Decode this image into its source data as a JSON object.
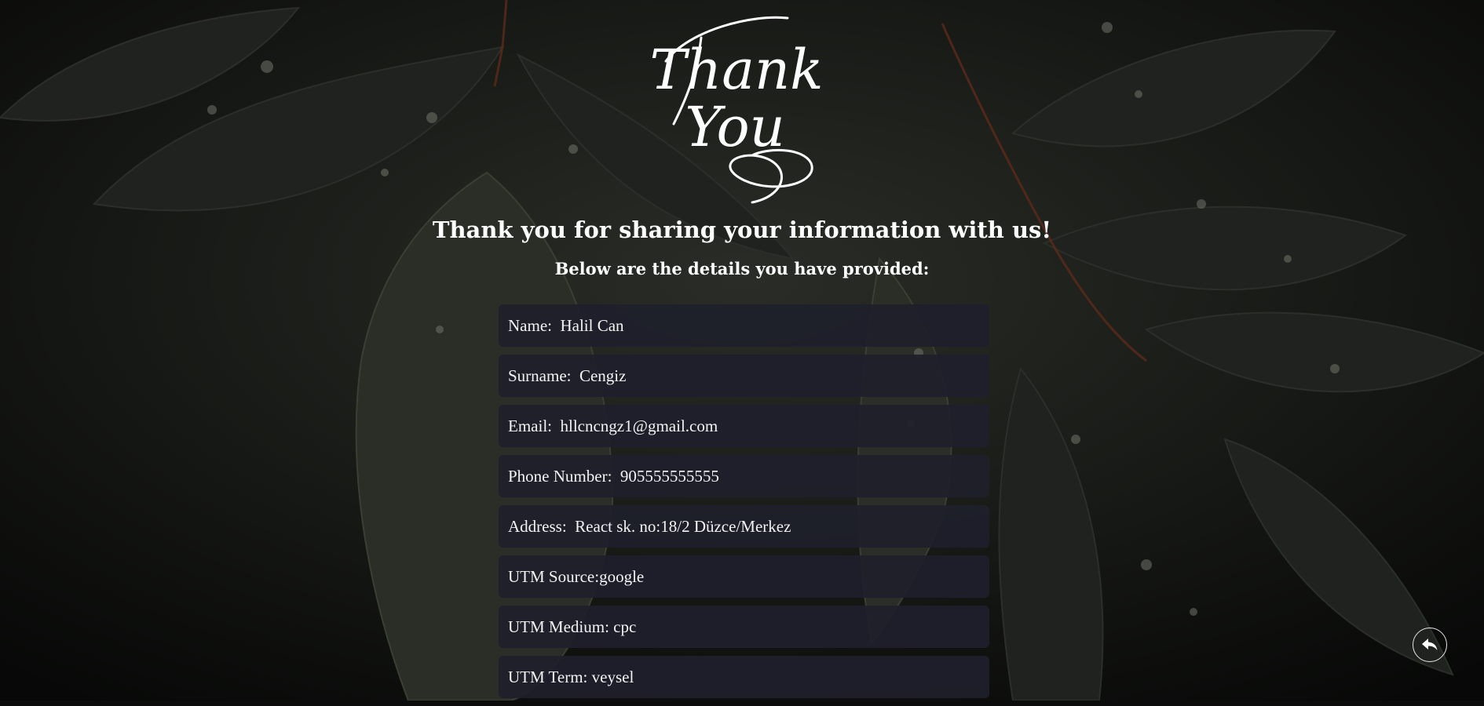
{
  "logo": {
    "line1": "Thank",
    "line2": "You"
  },
  "header": {
    "title": "Thank you for sharing your information with us!",
    "subtitle": "Below are the details you have provided:"
  },
  "details": [
    {
      "label": "Name:",
      "value": "Halil Can"
    },
    {
      "label": "Surname:",
      "value": "Cengiz"
    },
    {
      "label": "Email:",
      "value": "hllcncngz1@gmail.com"
    },
    {
      "label": "Phone Number:",
      "value": "905555555555"
    },
    {
      "label": "Address:",
      "value": "React sk. no:18/2 Düzce/Merkez"
    },
    {
      "label": "UTM Source:",
      "value": "google"
    },
    {
      "label": "UTM Medium:",
      "value": "cpc"
    },
    {
      "label": "UTM Term:",
      "value": "veysel"
    }
  ],
  "back_button": {
    "icon": "reply-arrow-icon"
  }
}
